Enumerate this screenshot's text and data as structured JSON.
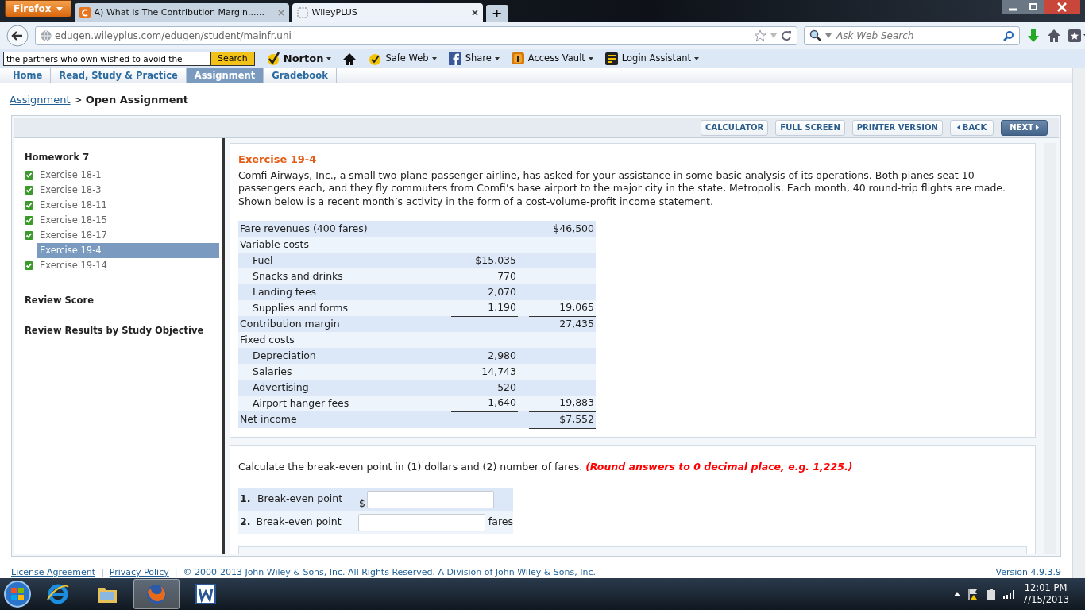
{
  "browser": {
    "menu_button": "Firefox",
    "tabs": [
      {
        "title": "A) What Is The Contribution Margin......",
        "kind": "chegg",
        "selected": false
      },
      {
        "title": "WileyPLUS",
        "kind": "blank",
        "selected": true
      }
    ],
    "new_tab": "+",
    "url": "edugen.wileyplus.com/edugen/student/mainfr.uni",
    "search": {
      "placeholder": "Ask Web Search"
    }
  },
  "toolbar": {
    "search_value": "the partners who own wished to avoid the",
    "search_button": "Search",
    "items": [
      {
        "kind": "norton",
        "label": "Norton"
      },
      {
        "kind": "home"
      },
      {
        "kind": "safeweb",
        "label": "Safe Web"
      },
      {
        "kind": "share",
        "label": "Share"
      },
      {
        "kind": "vault",
        "label": "Access Vault"
      },
      {
        "kind": "login",
        "label": "Login Assistant"
      }
    ]
  },
  "site_tabs": [
    {
      "label": "Home",
      "selected": false
    },
    {
      "label": "Read, Study & Practice",
      "selected": false
    },
    {
      "label": "Assignment",
      "selected": true
    },
    {
      "label": "Gradebook",
      "selected": false
    }
  ],
  "breadcrumb": {
    "link": "Assignment",
    "separator": ">",
    "current": "Open Assignment"
  },
  "panel_buttons": [
    {
      "label": "CALCULATOR",
      "kind": "plain"
    },
    {
      "label": "FULL SCREEN",
      "kind": "plain"
    },
    {
      "label": "PRINTER VERSION",
      "kind": "plain"
    },
    {
      "label": "BACK",
      "kind": "back"
    },
    {
      "label": "NEXT",
      "kind": "next"
    }
  ],
  "sidebar": {
    "title": "Homework 7",
    "items": [
      {
        "label": "Exercise 18-1",
        "done": true,
        "selected": false
      },
      {
        "label": "Exercise 18-3",
        "done": true,
        "selected": false
      },
      {
        "label": "Exercise 18-11",
        "done": true,
        "selected": false
      },
      {
        "label": "Exercise 18-15",
        "done": true,
        "selected": false
      },
      {
        "label": "Exercise 18-17",
        "done": true,
        "selected": false
      },
      {
        "label": "Exercise 19-4",
        "done": false,
        "selected": true
      },
      {
        "label": "Exercise 19-14",
        "done": true,
        "selected": false
      }
    ],
    "links": [
      "Review Score",
      "Review Results by Study Objective"
    ]
  },
  "exercise": {
    "title": "Exercise 19-4",
    "text": "Comfi Airways, Inc., a small two-plane passenger airline, has asked for your assistance in some basic analysis of its operations. Both planes seat 10 passengers each, and they fly commuters from Comfi’s base airport to the major city in the state, Metropolis. Each month, 40 round-trip flights are made. Shown below is a recent month’s activity in the form of a cost-volume-profit income statement.",
    "rows": [
      {
        "kind": "group",
        "label": "Fare revenues (400 fares)",
        "total": "$46,500"
      },
      {
        "kind": "group",
        "label": "Variable costs"
      },
      {
        "kind": "item",
        "label": "Fuel",
        "amount": "$15,035"
      },
      {
        "kind": "item",
        "label": "Snacks and drinks",
        "amount": "770"
      },
      {
        "kind": "item",
        "label": "Landing fees",
        "amount": "2,070"
      },
      {
        "kind": "item",
        "label": "Supplies and forms",
        "amount": "1,190",
        "total": "19,065",
        "amount_underlined": true,
        "total_underlined": true
      },
      {
        "kind": "group",
        "label": "Contribution margin",
        "total": "27,435"
      },
      {
        "kind": "group",
        "label": "Fixed costs"
      },
      {
        "kind": "item",
        "label": "Depreciation",
        "amount": "2,980"
      },
      {
        "kind": "item",
        "label": "Salaries",
        "amount": "14,743"
      },
      {
        "kind": "item",
        "label": "Advertising",
        "amount": "520"
      },
      {
        "kind": "item",
        "label": "Airport hanger fees",
        "amount": "1,640",
        "total": "19,883",
        "amount_underlined": true,
        "total_underlined": true
      },
      {
        "kind": "group",
        "label": "Net income",
        "total": "$7,552",
        "total_double_underlined": true
      }
    ]
  },
  "question": {
    "prompt": "Calculate the break-even point in (1) dollars and (2) number of fares.",
    "note": "(Round answers to 0 decimal place, e.g. 1,225.)",
    "answers": [
      {
        "number": "1.",
        "label": "Break-even point",
        "prefix": "$"
      },
      {
        "number": "2.",
        "label": "Break-even point",
        "suffix": "fares"
      }
    ]
  },
  "footer": {
    "links": [
      "License Agreement",
      "Privacy Policy"
    ],
    "separator": "|",
    "copyright": "© 2000-2013 John Wiley & Sons, Inc. All Rights Reserved. A Division of John Wiley & Sons, Inc.",
    "version": "Version 4.9.3.9"
  },
  "taskbar": {
    "apps": [
      {
        "kind": "ie",
        "active": false
      },
      {
        "kind": "folder",
        "active": false
      },
      {
        "kind": "firefox",
        "active": true
      },
      {
        "kind": "word",
        "active": false
      }
    ],
    "time": "12:01 PM",
    "date": "7/15/2013"
  }
}
